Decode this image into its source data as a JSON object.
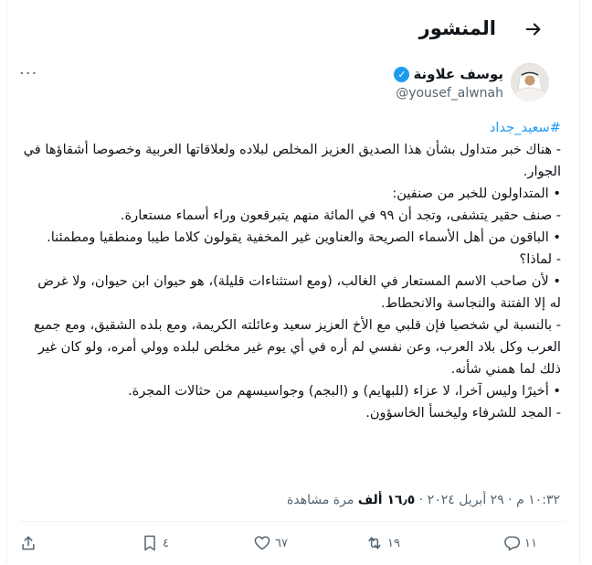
{
  "header": {
    "title": "المنشور",
    "back_icon": "arrow-right-icon"
  },
  "author": {
    "name": "يوسف علاونة",
    "handle": "@yousef_alwnah",
    "verified": true,
    "more_label": "···"
  },
  "post": {
    "hashtag": "#سعيد_جداد",
    "lines": [
      "- هناك خبر متداول بشأن هذا الصديق العزيز المخلص لبلاده ولعلاقاتها العربية وخصوصا أشقاؤها في الجوار.",
      "• المتداولون للخبر من صنفين:",
      "- صنف حقير يتشفى، وتجد أن ٩٩ في المائة منهم يتبرقعون وراء أسماء مستعارة.",
      "• الباقون من أهل الأسماء الصريحة والعناوين غير المخفية يقولون كلاما طيبا ومنطقيا ومطمئنا.",
      "- لماذا؟",
      "• لأن صاحب الاسم المستعار في الغالب، (ومع استثناءات قليلة)، هو حيوان ابن حيوان، ولا غرض له إلا الفتنة والنجاسة والانحطاط.",
      "- بالنسبة لي شخصيا فإن قلبي مع الأخ العزيز سعيد وعائلته الكريمة، ومع بلده الشقيق، ومع جميع العرب وكل بلاد العرب، وعن نفسي لم أره في أي يوم غير مخلص لبلده وولي أمره، ولو كان غير ذلك لما همني شأنه.",
      "• أخيرًا وليس آخرا، لا عزاء (للبهايم) و (البجم) وجواسيسهم من حثالات المجرة.",
      "- المجد للشرفاء وليخسأ الخاسؤون."
    ]
  },
  "meta": {
    "time": "١٠:٣٢ م",
    "date": "٢٩ أبريل ٢٠٢٤",
    "views_count": "١٦٫٥ ألف",
    "views_label": "مرة مشاهدة"
  },
  "actions": {
    "replies": "١١",
    "reposts": "١٩",
    "likes": "٦٧",
    "bookmarks": "٤"
  },
  "colors": {
    "accent": "#1d9bf0",
    "secondary_text": "#536471",
    "text": "#0f1419",
    "border": "#eff3f4"
  }
}
